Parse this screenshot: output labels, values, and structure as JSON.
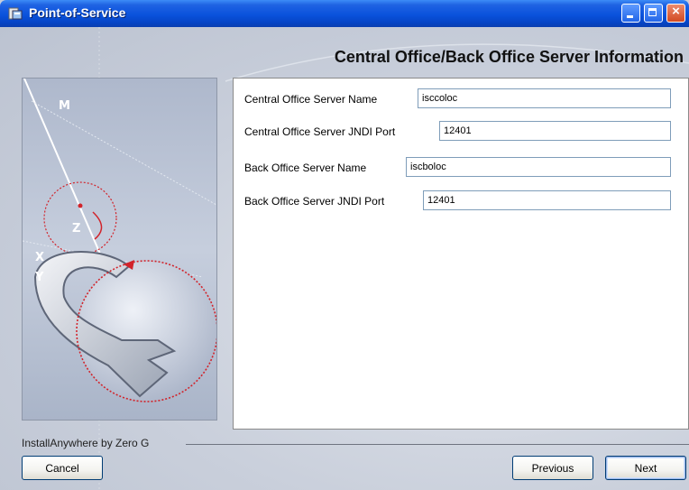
{
  "window": {
    "title": "Point-of-Service",
    "controls": {
      "minimize": "minimize-icon",
      "maximize": "maximize-icon",
      "close": "close-icon"
    }
  },
  "header": {
    "title": "Central Office/Back Office Server Information"
  },
  "side_art": {
    "letters": [
      "M",
      "Z",
      "X",
      "Y"
    ]
  },
  "form": {
    "fields": [
      {
        "label": "Central Office Server Name",
        "value": "isccoloc"
      },
      {
        "label": "Central Office Server JNDI Port",
        "value": "12401"
      },
      {
        "label": "Back Office Server Name",
        "value": "iscboloc"
      },
      {
        "label": "Back Office Server JNDI Port",
        "value": "12401"
      }
    ]
  },
  "footer": {
    "branding": "InstallAnywhere by Zero G",
    "cancel_label": "Cancel",
    "previous_label": "Previous",
    "next_label": "Next"
  },
  "colors": {
    "titlebar": "#0a52dc",
    "accent_red": "#d2232a",
    "panel_bg": "#c9cfdb"
  }
}
